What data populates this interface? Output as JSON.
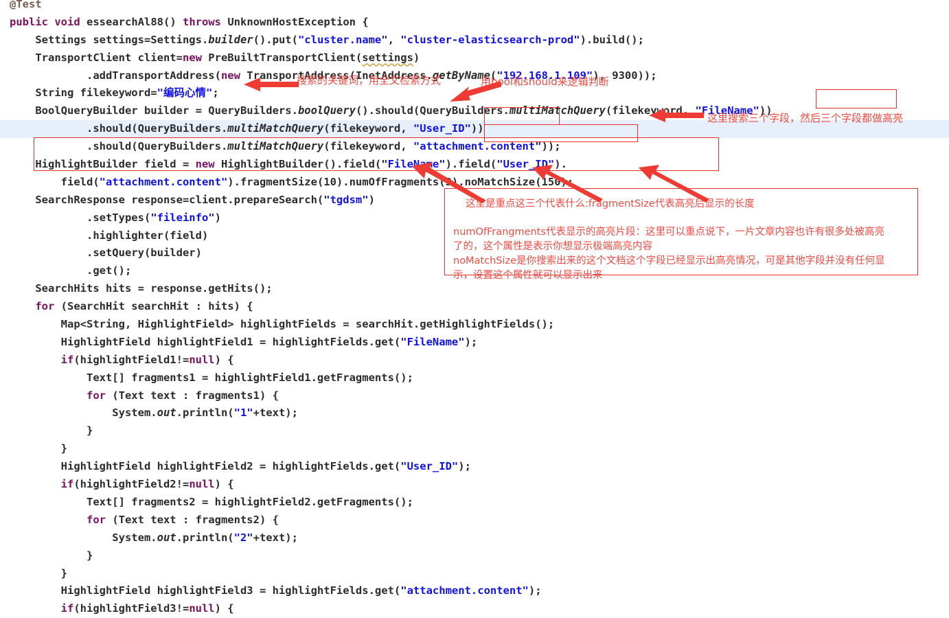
{
  "editor": {
    "language": "java",
    "selected_line_index": 7,
    "code_lines": [
      [
        {
          "t": "@Test",
          "c": "ann"
        }
      ],
      [
        {
          "t": "public",
          "c": "kw"
        },
        {
          "t": " ",
          "c": "id"
        },
        {
          "t": "void",
          "c": "kw"
        },
        {
          "t": " ",
          "c": "id"
        },
        {
          "t": "essearchAl88",
          "c": "id"
        },
        {
          "t": "() ",
          "c": "id"
        },
        {
          "t": "throws",
          "c": "kw"
        },
        {
          "t": " ",
          "c": "id"
        },
        {
          "t": "UnknownHostException",
          "c": "id"
        },
        {
          "t": " {",
          "c": "id"
        }
      ],
      [
        {
          "t": "    Settings settings=Settings.",
          "c": "id"
        },
        {
          "t": "builder",
          "c": "ital"
        },
        {
          "t": "().put(",
          "c": "id"
        },
        {
          "t": "\"cluster.name\"",
          "c": "str"
        },
        {
          "t": ", ",
          "c": "id"
        },
        {
          "t": "\"cluster-elasticsearch-prod\"",
          "c": "str"
        },
        {
          "t": ").build();",
          "c": "id"
        }
      ],
      [
        {
          "t": "    TransportClient client=",
          "c": "id"
        },
        {
          "t": "new",
          "c": "kw"
        },
        {
          "t": " PreBuiltTransportClient(",
          "c": "id"
        },
        {
          "t": "settings",
          "c": "squig"
        },
        {
          "t": ")",
          "c": "id"
        }
      ],
      [
        {
          "t": "            .addTransportAddress(",
          "c": "id"
        },
        {
          "t": "new",
          "c": "kw"
        },
        {
          "t": " TransportAddress(InetAddress.",
          "c": "id"
        },
        {
          "t": "getByName",
          "c": "ital"
        },
        {
          "t": "(",
          "c": "id"
        },
        {
          "t": "\"192.168.1.109\"",
          "c": "str"
        },
        {
          "t": "), 9300));",
          "c": "id"
        }
      ],
      [
        {
          "t": "    String filekeyword=",
          "c": "id"
        },
        {
          "t": "\"编码心情\"",
          "c": "str"
        },
        {
          "t": ";",
          "c": "id"
        }
      ],
      [
        {
          "t": "    BoolQueryBuilder builder = QueryBuilders.",
          "c": "id"
        },
        {
          "t": "boolQuery",
          "c": "ital"
        },
        {
          "t": "().should(QueryBuilders.",
          "c": "id"
        },
        {
          "t": "multiMatchQuery",
          "c": "ital"
        },
        {
          "t": "(filekeyword, ",
          "c": "id"
        },
        {
          "t": "\"FileName\"",
          "c": "str"
        },
        {
          "t": "))",
          "c": "id"
        }
      ],
      [
        {
          "t": "            .should(QueryBuilders.",
          "c": "id"
        },
        {
          "t": "multiMatchQuery",
          "c": "ital"
        },
        {
          "t": "(filekeyword, ",
          "c": "id"
        },
        {
          "t": "\"User_ID\"",
          "c": "str"
        },
        {
          "t": "))",
          "c": "id"
        }
      ],
      [
        {
          "t": "            .should(QueryBuilders.",
          "c": "id"
        },
        {
          "t": "multiMatchQuery",
          "c": "ital"
        },
        {
          "t": "(filekeyword, ",
          "c": "id"
        },
        {
          "t": "\"attachment.content\"",
          "c": "str"
        },
        {
          "t": "));",
          "c": "id"
        }
      ],
      [
        {
          "t": "    HighlightBuilder field = ",
          "c": "id"
        },
        {
          "t": "new",
          "c": "kw"
        },
        {
          "t": " HighlightBuilder().field(",
          "c": "id"
        },
        {
          "t": "\"FileName\"",
          "c": "str"
        },
        {
          "t": ").field(",
          "c": "id"
        },
        {
          "t": "\"User_ID\"",
          "c": "str"
        },
        {
          "t": ").",
          "c": "id"
        }
      ],
      [
        {
          "t": "        field(",
          "c": "id"
        },
        {
          "t": "\"attachment.content\"",
          "c": "str"
        },
        {
          "t": ").fragmentSize(10).numOfFragments(3).noMatchSize(150);",
          "c": "id"
        }
      ],
      [
        {
          "t": "    SearchResponse response=client.prepareSearch(",
          "c": "id"
        },
        {
          "t": "\"tgdsm\"",
          "c": "str"
        },
        {
          "t": ")",
          "c": "id"
        }
      ],
      [
        {
          "t": "            .setTypes(",
          "c": "id"
        },
        {
          "t": "\"fileinfo\"",
          "c": "str"
        },
        {
          "t": ")",
          "c": "id"
        }
      ],
      [
        {
          "t": "            .highlighter(field)",
          "c": "id"
        }
      ],
      [
        {
          "t": "            .setQuery(builder)",
          "c": "id"
        }
      ],
      [
        {
          "t": "            .get();",
          "c": "id"
        }
      ],
      [
        {
          "t": "    SearchHits hits = response.getHits();",
          "c": "id"
        }
      ],
      [
        {
          "t": "    ",
          "c": "id"
        },
        {
          "t": "for",
          "c": "kw"
        },
        {
          "t": " (SearchHit searchHit : hits) {",
          "c": "id"
        }
      ],
      [
        {
          "t": "        Map<String, HighlightField> highlightFields = searchHit.getHighlightFields();",
          "c": "id"
        }
      ],
      [
        {
          "t": "        HighlightField highlightField1 = highlightFields.get(",
          "c": "id"
        },
        {
          "t": "\"FileName\"",
          "c": "str"
        },
        {
          "t": ");",
          "c": "id"
        }
      ],
      [
        {
          "t": "        ",
          "c": "id"
        },
        {
          "t": "if",
          "c": "kw"
        },
        {
          "t": "(highlightField1!=",
          "c": "id"
        },
        {
          "t": "null",
          "c": "kw"
        },
        {
          "t": ") {",
          "c": "id"
        }
      ],
      [
        {
          "t": "            Text[] fragments1 = highlightField1.getFragments();",
          "c": "id"
        }
      ],
      [
        {
          "t": "            ",
          "c": "id"
        },
        {
          "t": "for",
          "c": "kw"
        },
        {
          "t": " (Text text : fragments1) {",
          "c": "id"
        }
      ],
      [
        {
          "t": "                System.",
          "c": "id"
        },
        {
          "t": "out",
          "c": "ital"
        },
        {
          "t": ".println(",
          "c": "id"
        },
        {
          "t": "\"1\"",
          "c": "str"
        },
        {
          "t": "+text);",
          "c": "id"
        }
      ],
      [
        {
          "t": "            }",
          "c": "id"
        }
      ],
      [
        {
          "t": "        }",
          "c": "id"
        }
      ],
      [
        {
          "t": "        HighlightField highlightField2 = highlightFields.get(",
          "c": "id"
        },
        {
          "t": "\"User_ID\"",
          "c": "str"
        },
        {
          "t": ");",
          "c": "id"
        }
      ],
      [
        {
          "t": "        ",
          "c": "id"
        },
        {
          "t": "if",
          "c": "kw"
        },
        {
          "t": "(highlightField2!=",
          "c": "id"
        },
        {
          "t": "null",
          "c": "kw"
        },
        {
          "t": ") {",
          "c": "id"
        }
      ],
      [
        {
          "t": "            Text[] fragments2 = highlightField2.getFragments();",
          "c": "id"
        }
      ],
      [
        {
          "t": "            ",
          "c": "id"
        },
        {
          "t": "for",
          "c": "kw"
        },
        {
          "t": " (Text text : fragments2) {",
          "c": "id"
        }
      ],
      [
        {
          "t": "                System.",
          "c": "id"
        },
        {
          "t": "out",
          "c": "ital"
        },
        {
          "t": ".println(",
          "c": "id"
        },
        {
          "t": "\"2\"",
          "c": "str"
        },
        {
          "t": "+text);",
          "c": "id"
        }
      ],
      [
        {
          "t": "            }",
          "c": "id"
        }
      ],
      [
        {
          "t": "        }",
          "c": "id"
        }
      ],
      [
        {
          "t": "        HighlightField highlightField3 = highlightFields.get(",
          "c": "id"
        },
        {
          "t": "\"attachment.content\"",
          "c": "str"
        },
        {
          "t": ");",
          "c": "id"
        }
      ],
      [
        {
          "t": "        ",
          "c": "id"
        },
        {
          "t": "if",
          "c": "kw"
        },
        {
          "t": "(highlightField3!=",
          "c": "id"
        },
        {
          "t": "null",
          "c": "kw"
        },
        {
          "t": ") {",
          "c": "id"
        }
      ]
    ]
  },
  "annotations": {
    "accent_color": "#e8302a",
    "text_color": "#f04a42",
    "selected_line_color": "#e7effb",
    "keyword_color": "#7b1060",
    "string_color": "#0f12e8",
    "notes": {
      "keyword_note": "搜索的关键词，用全文检索方式",
      "bool_should_note": "用bool和should来逻辑判断",
      "three_fields_note": "这里搜索三个字段，然后三个字段都做高亮",
      "box_line1": "这里是重点这三个代表什么:fragmentSize代表高亮后显示的长度",
      "box_line2": "numOfFrangments代表显示的高亮片段：这里可以重点说下，一片文章内容也许有很多处被高亮",
      "box_line3": "了的，这个属性是表示你想显示极端高亮内容",
      "box_line4": "noMatchSize是你搜索出来的这个文档这个字段已经显示出高亮情况，可是其他字段并没有任何显",
      "box_line5": "示，设置这个属性就可以显示出来"
    },
    "highlight_boxes": [
      {
        "name": "filename-literal-box",
        "label": "\"FileName\""
      },
      {
        "name": "userid-literal-box",
        "label": "\"User_ID\""
      },
      {
        "name": "attachment-content-literal-box",
        "label": "\"attachment.content\""
      },
      {
        "name": "highlight-builder-block-box",
        "label": "HighlightBuilder field = new HighlightBuilder()..."
      },
      {
        "name": "explanation-note-box",
        "label": "fragmentSize / numOfFragments / noMatchSize explanation"
      }
    ],
    "arrow_targets": [
      "filekeyword-string",
      "should-method",
      "multimatch-fields",
      "fragmentSize(10)",
      "numOfFragments(3)",
      "noMatchSize(150)"
    ]
  }
}
